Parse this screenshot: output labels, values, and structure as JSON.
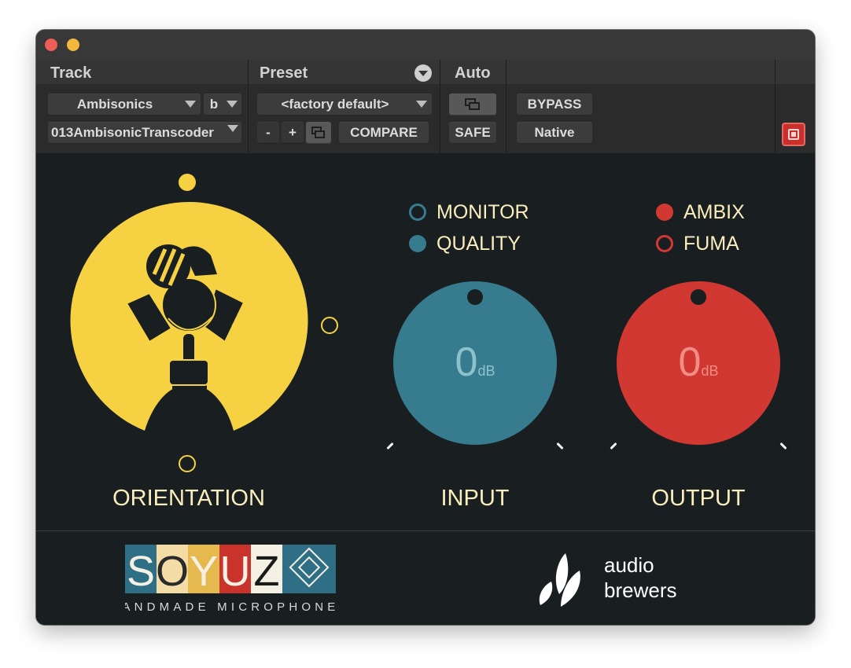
{
  "host": {
    "track": {
      "label": "Track",
      "type_value": "Ambisonics",
      "channel_value": "b",
      "name_value": "013AmbisonicTranscoder"
    },
    "preset": {
      "label": "Preset",
      "value": "<factory default>",
      "minus_label": "-",
      "plus_label": "+",
      "compare_label": "COMPARE"
    },
    "auto": {
      "label": "Auto",
      "safe_label": "SAFE"
    },
    "bypass_label": "BYPASS",
    "native_label": "Native"
  },
  "plugin": {
    "monitor_label": "MONITOR",
    "quality_label": "QUALITY",
    "selected_mode": "QUALITY",
    "ambix_label": "AMBIX",
    "fuma_label": "FUMA",
    "selected_format": "AMBIX",
    "input": {
      "value": "0",
      "unit": "dB",
      "label": "INPUT"
    },
    "output": {
      "value": "0",
      "unit": "dB",
      "label": "OUTPUT"
    },
    "orientation_label": "ORIENTATION"
  },
  "branding": {
    "soyuz_letters": [
      "S",
      "O",
      "Y",
      "U",
      "Z"
    ],
    "soyuz_tagline": "HANDMADE MICROPHONES",
    "brewers_line1": "audio",
    "brewers_line2": "brewers"
  },
  "colors": {
    "yellow": "#f6d243",
    "teal": "#377c8e",
    "red": "#d23832",
    "cream": "#fbeebd",
    "background": "#191e21"
  }
}
